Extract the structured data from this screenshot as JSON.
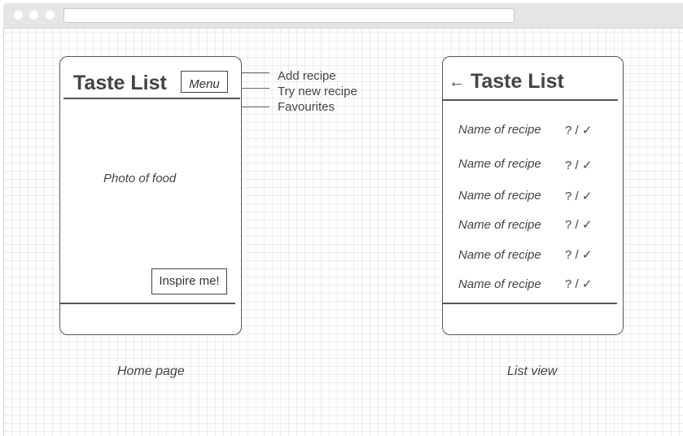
{
  "home": {
    "title": "Taste List",
    "menu_label": "Menu",
    "photo_text": "Photo of food",
    "inspire_label": "Inspire me!",
    "caption": "Home page"
  },
  "menu_options": [
    "Add recipe",
    "Try new recipe",
    "Favourites"
  ],
  "list": {
    "back_arrow": "←",
    "title": "Taste List",
    "recipes": [
      {
        "name": "Name of recipe",
        "status": "? / ✓"
      },
      {
        "name": "Name of recipe",
        "status": "? / ✓"
      },
      {
        "name": "Name of recipe",
        "status": "? / ✓"
      },
      {
        "name": "Name of recipe",
        "status": "? / ✓"
      },
      {
        "name": "Name of recipe",
        "status": "? / ✓"
      },
      {
        "name": "Name of recipe",
        "status": "? / ✓"
      }
    ],
    "caption": "List view"
  }
}
